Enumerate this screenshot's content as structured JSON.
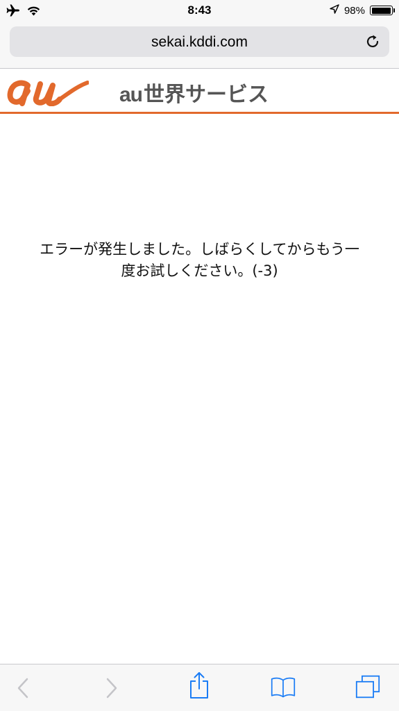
{
  "status_bar": {
    "time": "8:43",
    "battery": "98%",
    "battery_level": 0.98,
    "icons": [
      "airplane-icon",
      "wifi-icon",
      "location-arrow-icon",
      "battery-icon"
    ]
  },
  "address_bar": {
    "url": "sekai.kddi.com",
    "reload_icon": "reload-icon"
  },
  "site_header": {
    "logo_text": "au",
    "service_prefix": "au",
    "service_name": "世界サービス",
    "accent_color": "#e2692c"
  },
  "main": {
    "error_message_line1": "エラーが発生しました。しばらくしてからもう一",
    "error_message_line2": "度お試しください。(-3)"
  },
  "toolbar": {
    "icons": [
      "back-icon",
      "forward-icon",
      "share-icon",
      "bookmarks-icon",
      "tabs-icon"
    ]
  }
}
